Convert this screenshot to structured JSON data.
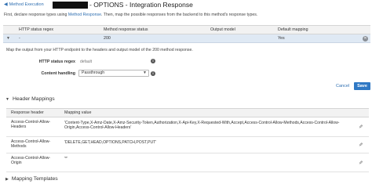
{
  "header": {
    "back_label": "Method Execution",
    "title": "- OPTIONS - Integration Response"
  },
  "intro": {
    "before": "First, declare response types using ",
    "link": "Method Response",
    "after": ". Then, map the possible responses from the backend to this method's response types."
  },
  "responses_table": {
    "columns": [
      "HTTP status regex",
      "Method response status",
      "Output model",
      "Default mapping"
    ],
    "rows": [
      {
        "regex": "-",
        "status": "200",
        "model": "",
        "default": "Yes"
      }
    ]
  },
  "detail": {
    "description": "Map the output from your HTTP endpoint to the headers and output model of the 200 method response.",
    "regex_label": "HTTP status regex",
    "regex_placeholder": "default",
    "content_handling_label": "Content handling",
    "content_handling_value": "Passthrough"
  },
  "buttons": {
    "cancel": "Cancel",
    "save": "Save"
  },
  "header_mappings": {
    "title": "Header Mappings",
    "columns": [
      "Response header",
      "Mapping value"
    ],
    "rows": [
      {
        "header": "Access-Control-Allow-Headers",
        "value": "'Content-Type,X-Amz-Date,X-Amz-Security-Token,Authorization,X-Api-Key,X-Requested-With,Accept,Access-Control-Allow-Methods,Access-Control-Allow-Origin,Access-Control-Allow-Headers'"
      },
      {
        "header": "Access-Control-Allow-Methods",
        "value": "'DELETE,GET,HEAD,OPTIONS,PATCH,POST,PUT'"
      },
      {
        "header": "Access-Control-Allow-Origin",
        "value": "'*'"
      }
    ]
  },
  "mapping_templates": {
    "title": "Mapping Templates"
  },
  "icons": {
    "back": "left-arrow-icon",
    "info": "info-icon",
    "edit": "pencil-icon",
    "remove": "close-circle-icon",
    "expand": "caret-icon"
  },
  "colors": {
    "link": "#2f6fb1",
    "selected_row": "#dfe9f4",
    "primary_button": "#2f78c4"
  }
}
